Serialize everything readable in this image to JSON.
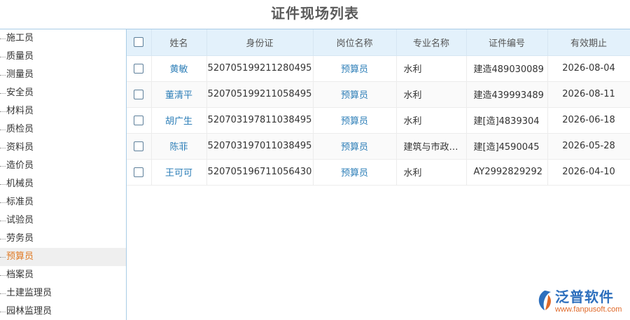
{
  "page": {
    "title": "证件现场列表"
  },
  "sidebar": {
    "items": [
      {
        "label": "施工员"
      },
      {
        "label": "质量员"
      },
      {
        "label": "测量员"
      },
      {
        "label": "安全员"
      },
      {
        "label": "材料员"
      },
      {
        "label": "质检员"
      },
      {
        "label": "资料员"
      },
      {
        "label": "造价员"
      },
      {
        "label": "机械员"
      },
      {
        "label": "标准员"
      },
      {
        "label": "试验员"
      },
      {
        "label": "劳务员"
      },
      {
        "label": "预算员",
        "active": true
      },
      {
        "label": "档案员"
      },
      {
        "label": "土建监理员"
      },
      {
        "label": "园林监理员"
      }
    ]
  },
  "table": {
    "columns": [
      "姓名",
      "身份证",
      "岗位名称",
      "专业名称",
      "证件编号",
      "有效期止"
    ],
    "rows": [
      {
        "name": "黄敏",
        "id_number": "520705199211280495",
        "position": "预算员",
        "major": "水利",
        "cert_no": "建造489030089",
        "valid_until": "2026-08-04"
      },
      {
        "name": "董清平",
        "id_number": "520705199211058495",
        "position": "预算员",
        "major": "水利",
        "cert_no": "建造439993489",
        "valid_until": "2026-08-11"
      },
      {
        "name": "胡广生",
        "id_number": "520703197811038495",
        "position": "预算员",
        "major": "水利",
        "cert_no": "建[造]4839304",
        "valid_until": "2026-06-18"
      },
      {
        "name": "陈菲",
        "id_number": "520703197011038495",
        "position": "预算员",
        "major": "建筑与市政…",
        "cert_no": "建[造]4590045",
        "valid_until": "2026-05-28"
      },
      {
        "name": "王可可",
        "id_number": "520705196711056430",
        "position": "预算员",
        "major": "水利",
        "cert_no": "AY2992829292",
        "valid_until": "2026-04-10"
      }
    ]
  },
  "logo": {
    "text": "泛普软件",
    "url": "www.fanpusoft.com",
    "brand_color": "#2d6fbd",
    "accent_color": "#e06a2a",
    "icon": "fanpu-logo-icon"
  },
  "colors": {
    "header_bg": "#e3f1fb",
    "active_item": "#e07b26",
    "link": "#2e7fb8",
    "border": "#a9cce6"
  }
}
